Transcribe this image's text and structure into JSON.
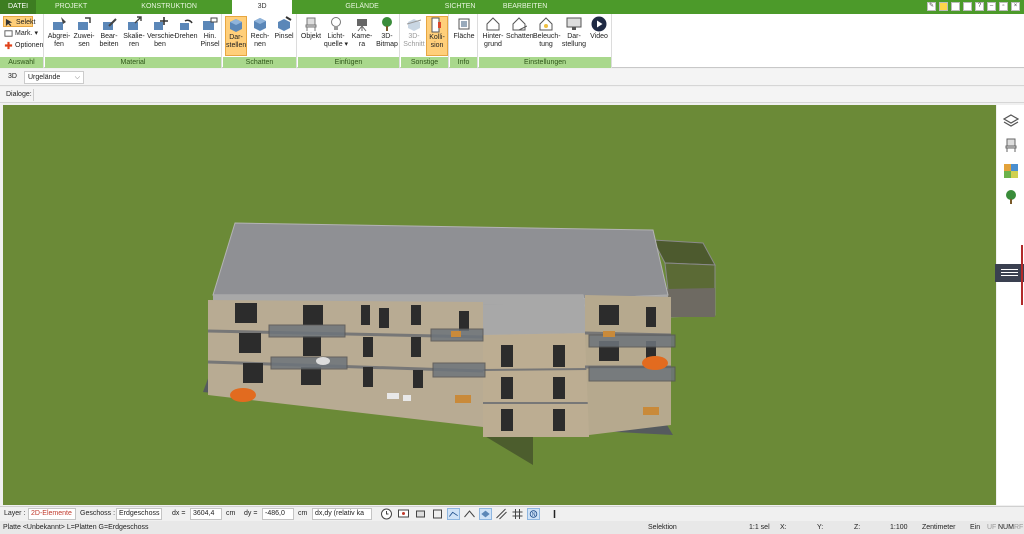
{
  "tabs": [
    "DATEI",
    "PROJEKT",
    "KONSTRUKTION",
    "3D",
    "GELÄNDE",
    "SICHTEN",
    "BEARBEITEN"
  ],
  "ribbon": {
    "auswahl": {
      "label": "Auswahl",
      "selekt": "Selekt",
      "mark": "Mark.",
      "optionen": "Optionen"
    },
    "material": {
      "label": "Material",
      "buttons": [
        "Abgrei-\nfen",
        "Zuwei-\nsen",
        "Bear-\nbeiten",
        "Skalie-\nren",
        "Verschie-\nben",
        "Drehen",
        "Hin.\nPinsel"
      ]
    },
    "schatten": {
      "label": "Schatten",
      "buttons": [
        "Dar-\nstellen",
        "Rech-\nnen",
        "Pinsel"
      ]
    },
    "einfuegen": {
      "label": "Einfügen",
      "buttons": [
        "Objekt",
        "Licht-\nquelle ▾",
        "Kame-\nra",
        "3D-\nBitmap"
      ]
    },
    "sonstige": {
      "label": "Sonstige",
      "buttons": [
        "3D-\nSchnitt",
        "Kolli-\nsion"
      ]
    },
    "info": {
      "label": "Info",
      "buttons": [
        "Fläche"
      ]
    },
    "einstellungen": {
      "label": "Einstellungen",
      "buttons": [
        "Hinter-\ngrund",
        "Schatten",
        "Beleuch-\ntung",
        "Dar-\nstellung",
        "Video"
      ]
    }
  },
  "view": {
    "mode_label": "3D",
    "terrain_select": "Urgelände"
  },
  "dialog": {
    "label": "Dialoge:"
  },
  "bottombar": {
    "layer_label": "Layer :",
    "layer_value": "2D-Elemente",
    "geschoss_label": "Geschoss :",
    "geschoss_value": "Erdgeschoss",
    "dx_label": "dx =",
    "dx_value": "3604,4",
    "dx_unit": "cm",
    "dy_label": "dy =",
    "dy_value": "-486,0",
    "dy_unit": "cm",
    "mode_value": "dx,dy (relativ ka"
  },
  "statusbar": {
    "hint": "Platte <Unbekannt> L=Platten G=Erdgeschoss",
    "mode": "Selektion",
    "selection": "1:1 sel",
    "x": "X:",
    "y": "Y:",
    "z": "Z:",
    "scale": "1:100",
    "unit": "Zentimeter",
    "ein": "Ein",
    "flags": [
      "UF",
      "NUM",
      "RF"
    ]
  },
  "colors": {
    "tab_green": "#4c9a2a",
    "group_label": "#a9d88c",
    "active_button": "#ffcf7a",
    "lawn": "#6b8a37"
  }
}
